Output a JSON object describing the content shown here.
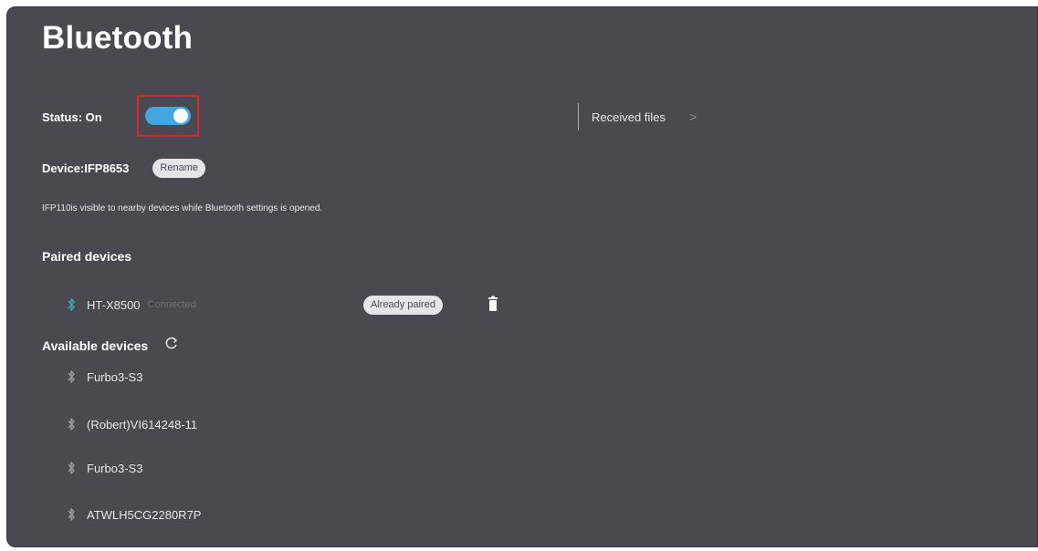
{
  "title": "Bluetooth",
  "status": {
    "label": "Status: On",
    "enabled": true
  },
  "received_files": {
    "label": "Received files",
    "chevron": ">"
  },
  "device": {
    "label": "Device:IFP8653",
    "rename_label": "Rename"
  },
  "visibility_note": "IFP110is visible to nearby devices while Bluetooth settings is opened.",
  "paired": {
    "heading": "Paired devices",
    "devices": [
      {
        "name": "HT-X8500",
        "status": "Connected",
        "action_label": "Already paired"
      }
    ]
  },
  "available": {
    "heading": "Available devices",
    "refresh_icon": "refresh-icon",
    "devices": [
      {
        "name": "Furbo3-S3"
      },
      {
        "name": "(Robert)VI614248-11"
      },
      {
        "name": "Furbo3-S3"
      },
      {
        "name": "ATWLH5CG2280R7P"
      }
    ]
  },
  "colors": {
    "background": "#4a4952",
    "toggle_on": "#42a6e0",
    "highlight": "#d62a2a",
    "bluetooth_paired": "#3aa6a0"
  }
}
